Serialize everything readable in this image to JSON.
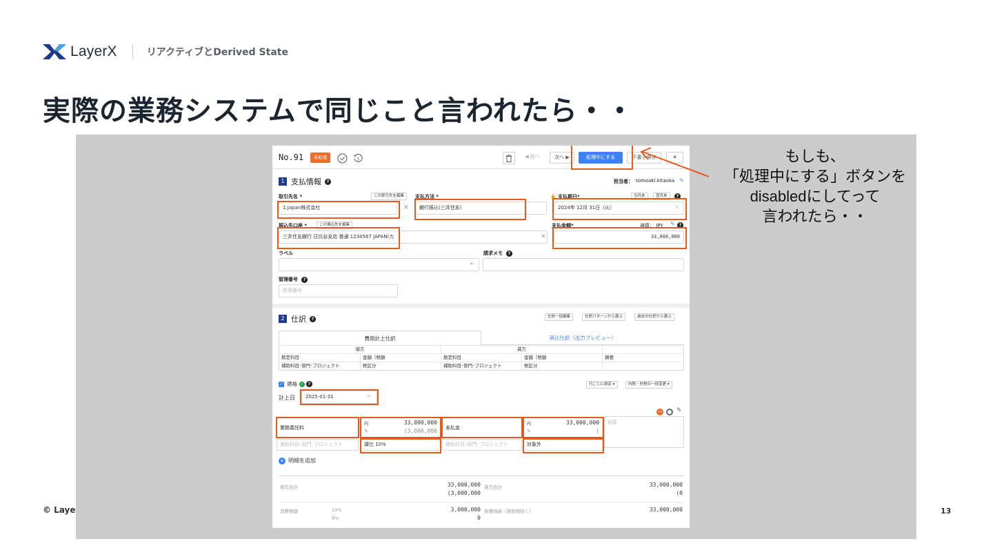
{
  "slide": {
    "brand": "LayerX",
    "subtitle": "リアクティブとDerived State",
    "title": "実際の業務システムで同じこと言われたら・・",
    "footer": "© LayerX",
    "page": "13",
    "callout": [
      "もしも、",
      "「処理中にする」ボタンを",
      "disabledにしてって",
      "言われたら・・"
    ]
  },
  "app": {
    "topbar": {
      "number": "No.91",
      "status_badge": "未処理",
      "prev_label": "◀ 前へ",
      "next_label": "次へ ▶",
      "processing_label": "処理中にする",
      "draft_label": "下書き保存",
      "close_label": "✕"
    },
    "payment": {
      "section_no": "1",
      "section_title": "支払情報",
      "assignee_label": "担当者：",
      "assignee": "tomoaki.kitaoka",
      "vendor_label": "取引先名 *",
      "vendor_edit": "この取引先を編集",
      "vendor_value": "1:Japan株式会社",
      "method_label": "支払方法 *",
      "method_value": "銀行振込(三井住友)",
      "due_label": "支払期日*",
      "this_month": "当月末",
      "next_month": "翌月末",
      "due_value": "2024年 12月 31日（火）",
      "bank_label": "振込先口座 *",
      "bank_edit": "この振込先を編集",
      "bank_value": "三井住友銀行 日比谷支店 普通 1234567 JAPAN(カ",
      "amount_label": "支払金額*",
      "currency_label": "通貨： JPY",
      "amount_value": "33,000,000",
      "tag_label": "ラベル",
      "memo_label": "請求メモ",
      "mgmt_label": "管理番号",
      "mgmt_placeholder": "管理番号"
    },
    "journal": {
      "section_no": "2",
      "section_title": "仕訳",
      "btn_bulk": "仕訳一括編集",
      "btn_pattern": "仕訳パターンから選ぶ",
      "btn_past": "過去の仕訳から選ぶ",
      "tab_active": "費用計上仕訳",
      "tab_other": "消込仕訳（出力プレビュー）",
      "debit": "借方",
      "credit": "貸方",
      "col_account": "勘定科目",
      "col_amount": "金額（税額",
      "col_sub": "補助科目･部門･プロジェクト",
      "col_tax": "税区分",
      "col_desc": "摘要",
      "qualified": "適格",
      "row_setting": "行ごとに設定 ▾",
      "tax_change": "内税・外税の一括変更 ▾",
      "date_label": "計上日",
      "date_value": "2025-01-31",
      "debit_account": "業務委託料",
      "debit_sub_ph": "補助科目･部門･プロジェクト",
      "debit_prefix": "内",
      "debit_amount": "33,000,000",
      "debit_tax": "(3,000,000",
      "debit_taxcat": "課仕 10%",
      "credit_account": "未払金",
      "credit_sub_ph": "補助科目･部門･プロジェクト",
      "credit_prefix": "内",
      "credit_amount": "33,000,000",
      "credit_tax": "(",
      "credit_taxcat": "対象外",
      "desc_ph": "摘要",
      "add_line": "明細を追加"
    },
    "summary": {
      "debit_total_label": "借方合計",
      "debit_total": "33,000,000",
      "debit_total_tax": "(3,000,000",
      "credit_total_label": "貸方合計",
      "credit_total": "33,000,000",
      "credit_total_tax": "(0",
      "tax_label": "消費税額",
      "rate10": "10%",
      "rate8": "8%",
      "tax_total": "3,000,000",
      "tax_zero": "0",
      "liability_label": "負債残高（源泉税除く）",
      "liability_total": "33,000,000"
    }
  },
  "colors": {
    "highlight": "#e8591a",
    "primary": "#3b82f6",
    "stage": "#cccccc",
    "badge": "#ef6b2a"
  }
}
